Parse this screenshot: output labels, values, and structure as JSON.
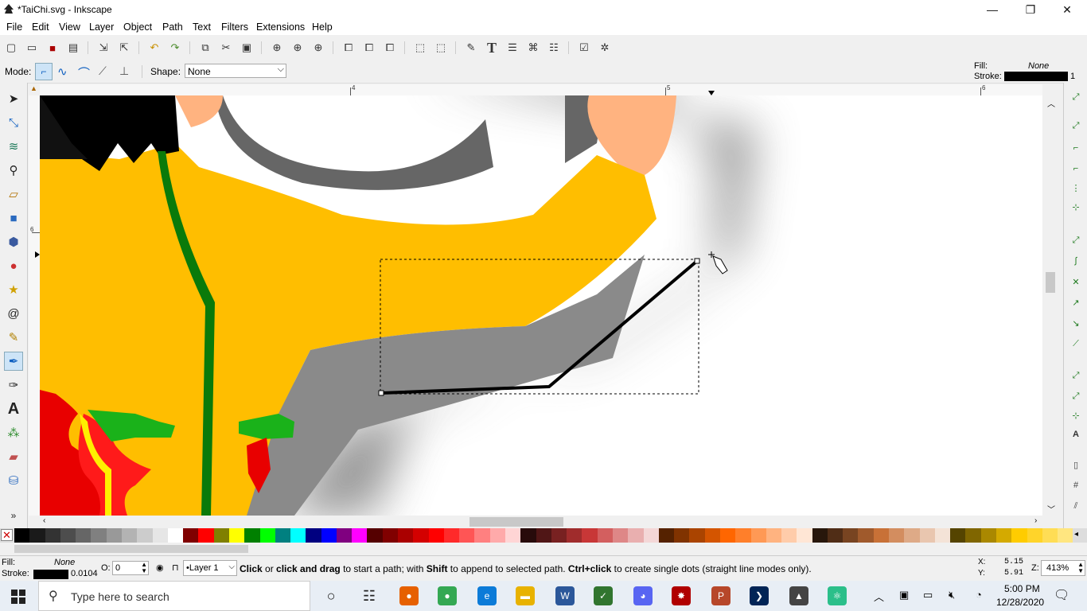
{
  "window": {
    "title": "*TaiChi.svg - Inkscape",
    "minimize_glyph": "—",
    "maximize_glyph": "❐",
    "close_glyph": "✕"
  },
  "menu": [
    "File",
    "Edit",
    "View",
    "Layer",
    "Object",
    "Path",
    "Text",
    "Filters",
    "Extensions",
    "Help"
  ],
  "toolbar": {
    "icons": [
      "new-document-icon",
      "open-folder-icon",
      "save-icon",
      "print-icon",
      "import-icon",
      "export-icon",
      "undo-icon",
      "redo-icon",
      "copy-icon",
      "cut-icon",
      "paste-icon",
      "zoom-selection-icon",
      "zoom-drawing-icon",
      "zoom-page-icon",
      "duplicate-icon",
      "clone-icon",
      "unlink-clone-icon",
      "group-icon",
      "ungroup-icon",
      "fill-stroke-icon",
      "text-font-icon",
      "layers-icon",
      "xml-editor-icon",
      "align-distribute-icon",
      "document-properties-icon",
      "preferences-icon"
    ]
  },
  "controls": {
    "mode_label": "Mode:",
    "shape_label": "Shape:",
    "shape_value": "None",
    "fill_label": "Fill:",
    "fill_value": "None",
    "stroke_label": "Stroke:",
    "stroke_value": "1"
  },
  "ruler": {
    "labels": [
      "4",
      "5",
      "6"
    ],
    "vlabels": [
      "6"
    ]
  },
  "tools": [
    "selector-arrow-icon",
    "node-tool-icon",
    "tweak-tool-icon",
    "zoom-tool-icon",
    "measure-tool-icon",
    "rectangle-tool-icon",
    "3d-box-tool-icon",
    "ellipse-tool-icon",
    "star-tool-icon",
    "spiral-tool-icon",
    "pencil-tool-icon",
    "bezier-pen-tool-icon",
    "calligraphy-tool-icon",
    "text-tool-icon",
    "spray-tool-icon",
    "eraser-tool-icon",
    "paint-bucket-tool-icon"
  ],
  "tools_more": "»",
  "palette": {
    "colors": [
      "#000000",
      "#1a1a1a",
      "#333333",
      "#4d4d4d",
      "#666666",
      "#808080",
      "#999999",
      "#b3b3b3",
      "#cccccc",
      "#e6e6e6",
      "#ffffff",
      "#800000",
      "#ff0000",
      "#808000",
      "#ffff00",
      "#008000",
      "#00ff00",
      "#008080",
      "#00ffff",
      "#000080",
      "#0000ff",
      "#800080",
      "#ff00ff",
      "#550000",
      "#800000",
      "#aa0000",
      "#d40000",
      "#ff0000",
      "#ff2a2a",
      "#ff5555",
      "#ff8080",
      "#ffaaaa",
      "#ffd5d5",
      "#280b0b",
      "#501616",
      "#782121",
      "#a02c2c",
      "#c83737",
      "#d35f5f",
      "#de8787",
      "#e9afaf",
      "#f4d7d7",
      "#552200",
      "#803300",
      "#aa4400",
      "#d45500",
      "#ff6600",
      "#ff7f2a",
      "#ff9955",
      "#ffb380",
      "#ffccaa",
      "#ffe6d5",
      "#28170b",
      "#502d16",
      "#784421",
      "#a05a2c",
      "#c87137",
      "#d38d5f",
      "#deaa87",
      "#e9c6af",
      "#f4e3d7",
      "#554400",
      "#806600",
      "#aa8800",
      "#d4aa00",
      "#ffcc00",
      "#ffd42a",
      "#ffdd55",
      "#ffe680"
    ]
  },
  "status": {
    "fill_label": "Fill:",
    "fill_value": "None",
    "stroke_label": "Stroke:",
    "stroke_width": "0.0104",
    "opacity_label": "O:",
    "opacity_value": "0",
    "layer_value": "•Layer 1",
    "message_parts": [
      "Click",
      " or ",
      "click and drag",
      " to start a path; with ",
      "Shift",
      " to append to selected path. ",
      "Ctrl+click",
      " to create single dots (straight line modes only)."
    ],
    "x_label": "X:",
    "x_value": "5.15",
    "y_label": "Y:",
    "y_value": "5.91",
    "z_label": "Z:",
    "zoom_value": "413%"
  },
  "taskbar": {
    "search_placeholder": "Type here to search",
    "apps": [
      {
        "name": "cortana-icon",
        "color": "#222",
        "glyph": "○"
      },
      {
        "name": "task-view-icon",
        "color": "#222",
        "glyph": "☷"
      },
      {
        "name": "firefox-icon",
        "color": "#e66000",
        "glyph": "●"
      },
      {
        "name": "chrome-icon",
        "color": "#34a853",
        "glyph": "●"
      },
      {
        "name": "edge-icon",
        "color": "#0c7bd8",
        "glyph": "e"
      },
      {
        "name": "file-explorer-icon",
        "color": "#e8b200",
        "glyph": "▬"
      },
      {
        "name": "word-icon",
        "color": "#2b579a",
        "glyph": "W"
      },
      {
        "name": "project-icon",
        "color": "#31752f",
        "glyph": "✓"
      },
      {
        "name": "discord-icon",
        "color": "#5865f2",
        "glyph": "◕"
      },
      {
        "name": "paint-splat-icon",
        "color": "#b00000",
        "glyph": "✸"
      },
      {
        "name": "powerpoint-app-icon",
        "color": "#b7472a",
        "glyph": "P"
      },
      {
        "name": "powershell-icon",
        "color": "#012456",
        "glyph": "❯"
      },
      {
        "name": "inkscape-taskbar-icon",
        "color": "#444",
        "glyph": "▲"
      },
      {
        "name": "atom-icon",
        "color": "#2bbf8a",
        "glyph": "⚛"
      }
    ],
    "tray_icons": [
      "chevron-up-icon",
      "meeting-icon",
      "battery-icon",
      "volume-muted-icon",
      "wifi-icon"
    ],
    "time": "5:00 PM",
    "date": "12/28/2020",
    "notification_icon": "notification-icon"
  }
}
